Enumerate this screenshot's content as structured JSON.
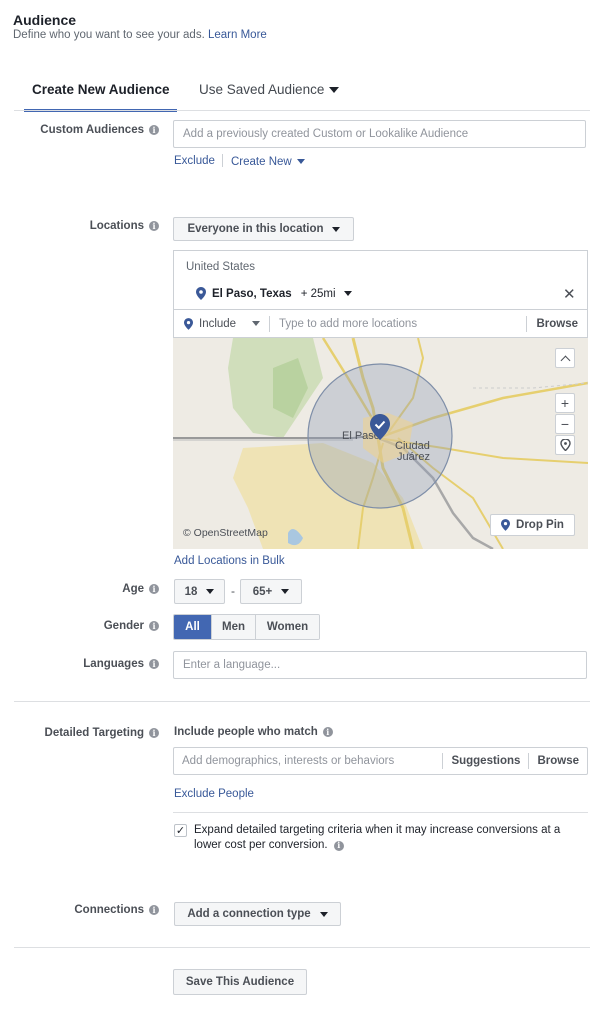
{
  "header": {
    "title": "Audience",
    "subtitle": "Define who you want to see your ads.",
    "learn_more": "Learn More"
  },
  "tabs": [
    {
      "label": "Create New Audience",
      "active": true
    },
    {
      "label": "Use Saved Audience",
      "active": false
    }
  ],
  "custom_audiences": {
    "label": "Custom Audiences",
    "placeholder": "Add a previously created Custom or Lookalike Audience",
    "exclude": "Exclude",
    "create_new": "Create New"
  },
  "locations": {
    "label": "Locations",
    "mode": "Everyone in this location",
    "country": "United States",
    "selected_city": "El Paso, Texas",
    "radius": "+ 25mi",
    "include": "Include",
    "placeholder": "Type to add more locations",
    "browse": "Browse",
    "map": {
      "city_label": "El Paso",
      "city2_line1": "Ciudad",
      "city2_line2": "Juárez",
      "attribution": "© OpenStreetMap",
      "drop_pin": "Drop Pin"
    },
    "bulk_link": "Add Locations in Bulk"
  },
  "age": {
    "label": "Age",
    "min": "18",
    "separator": "-",
    "max": "65+"
  },
  "gender": {
    "label": "Gender",
    "options": [
      "All",
      "Men",
      "Women"
    ],
    "selected": "All"
  },
  "languages": {
    "label": "Languages",
    "placeholder": "Enter a language..."
  },
  "detailed_targeting": {
    "label": "Detailed Targeting",
    "heading": "Include people who match",
    "placeholder": "Add demographics, interests or behaviors",
    "suggestions": "Suggestions",
    "browse": "Browse",
    "exclude_people": "Exclude People",
    "expand_line1": "Expand detailed targeting criteria when it may increase conversions at a",
    "expand_line2": "lower cost per conversion.",
    "expand_checked": true
  },
  "connections": {
    "label": "Connections",
    "button": "Add a connection type"
  },
  "save_button": "Save This Audience",
  "colors": {
    "accent": "#4267b2",
    "link": "#385898",
    "pin": "#3b5998"
  },
  "icons": {
    "info": "info-icon",
    "pin": "location-pin-icon",
    "close": "close-icon",
    "check": "checkmark-icon"
  }
}
